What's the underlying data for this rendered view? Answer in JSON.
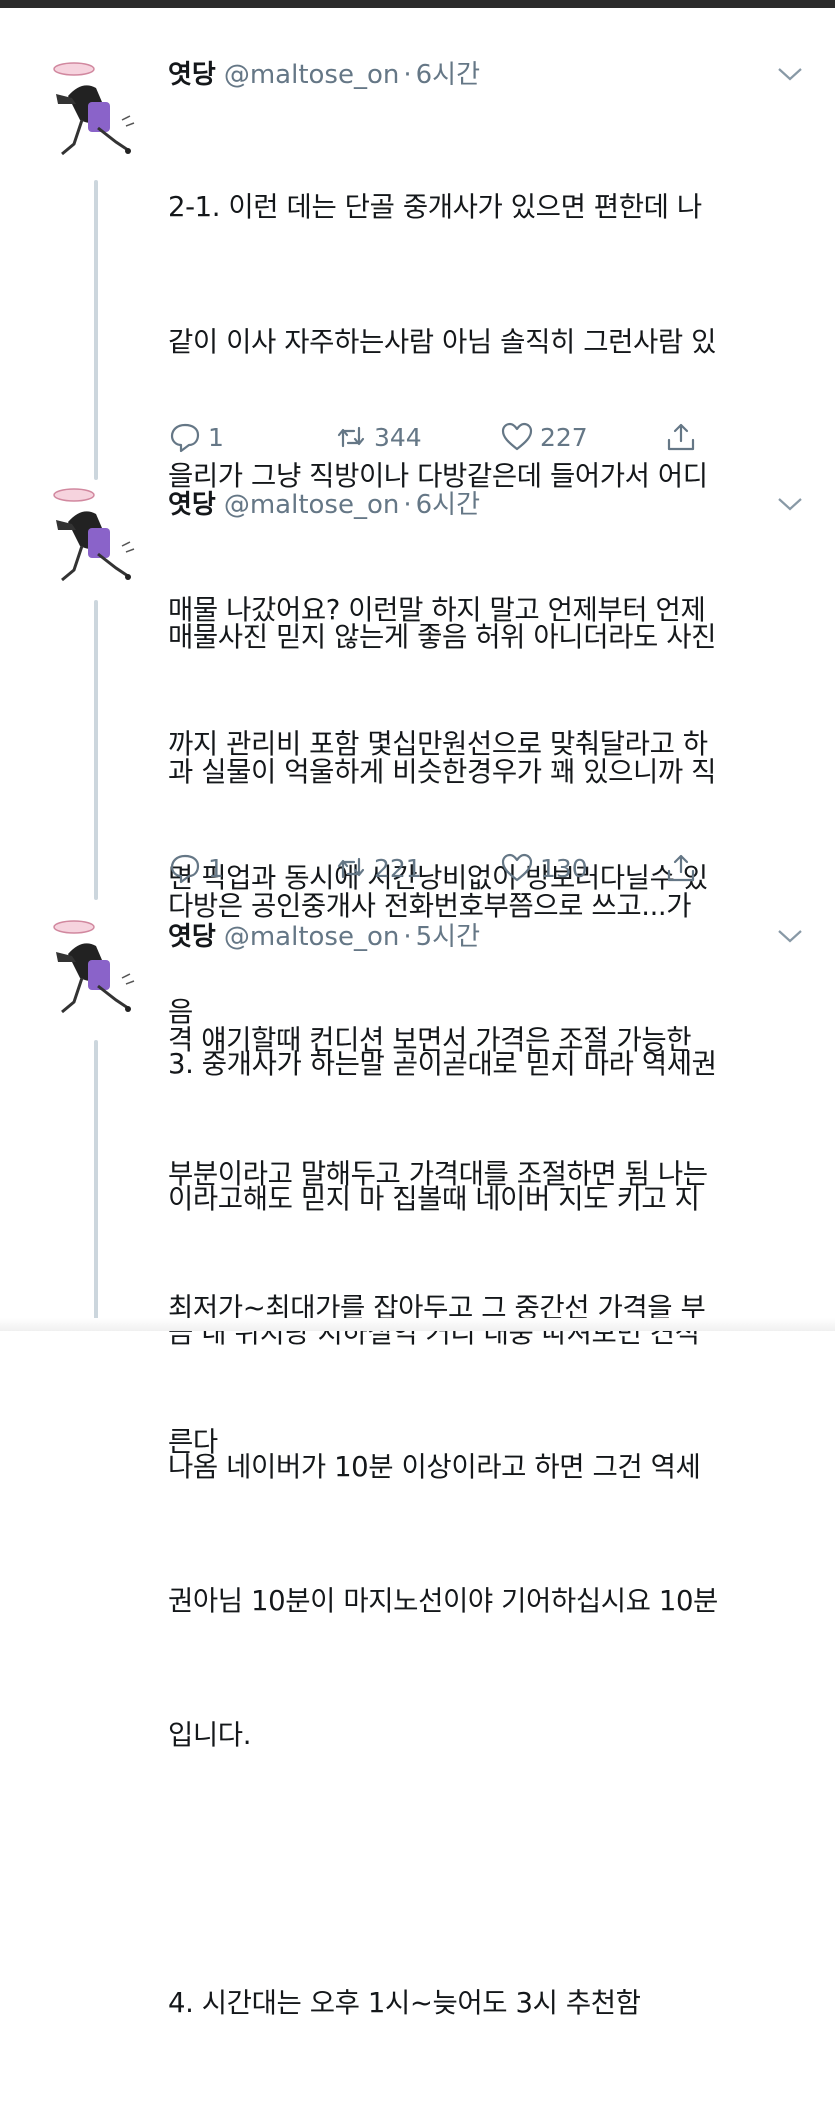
{
  "tweets": [
    {
      "name": "엿당",
      "handle": "@maltose_on",
      "dot": "·",
      "time": "6시간",
      "lines": [
        "2-1. 이런 데는 단골 중개사가 있으면 편한데 나",
        "같이 이사 자주하는사람 아님 솔직히 그런사람 있",
        "을리가 그냥 직방이나 다방같은데 들어가서 어디",
        "매물 나갔어요? 이런말 하지 말고 언제부터 언제",
        "까지 관리비 포함 몇십만원선으로 맞춰달라고 하",
        "면 픽업과 동시에 시간낭비없이 방보러다닐수 있",
        "음"
      ],
      "replies": "1",
      "retweets": "344",
      "likes": "227"
    },
    {
      "name": "엿당",
      "handle": "@maltose_on",
      "dot": "·",
      "time": "6시간",
      "lines": [
        "매물사진 믿지 않는게 좋음 허위 아니더라도 사진",
        "과 실물이 억울하게 비슷한경우가 꽤 있으니까 직",
        "다방은 공인중개사 전화번호부쯤으로 쓰고...가",
        "격 얘기할때 컨디션 보면서 가격은 조절 가능한",
        "부분이라고 말해두고 가격대를 조절하면 됨 나는",
        "최저가~최대가를 잡아두고 그 중간선 가격을 부",
        "른다"
      ],
      "replies": "1",
      "retweets": "221",
      "likes": "130"
    },
    {
      "name": "엿당",
      "handle": "@maltose_on",
      "dot": "·",
      "time": "5시간",
      "lines": [
        "3. 중개사가 하는말 곧이곧대로 믿지 마라 역세권",
        "이라고해도 믿지 마 집볼때 네이버 지도 키고 지",
        "금 내 위치랑 지하철역 거리 대충 따져보면 견적",
        "나옴 네이버가 10분 이상이라고 하면 그건 역세",
        "권아님 10분이 마지노선이야 기어하십시요 10분",
        "입니다.",
        "",
        "4. 시간대는 오후 1시~늦어도 3시 추천함"
      ]
    }
  ]
}
